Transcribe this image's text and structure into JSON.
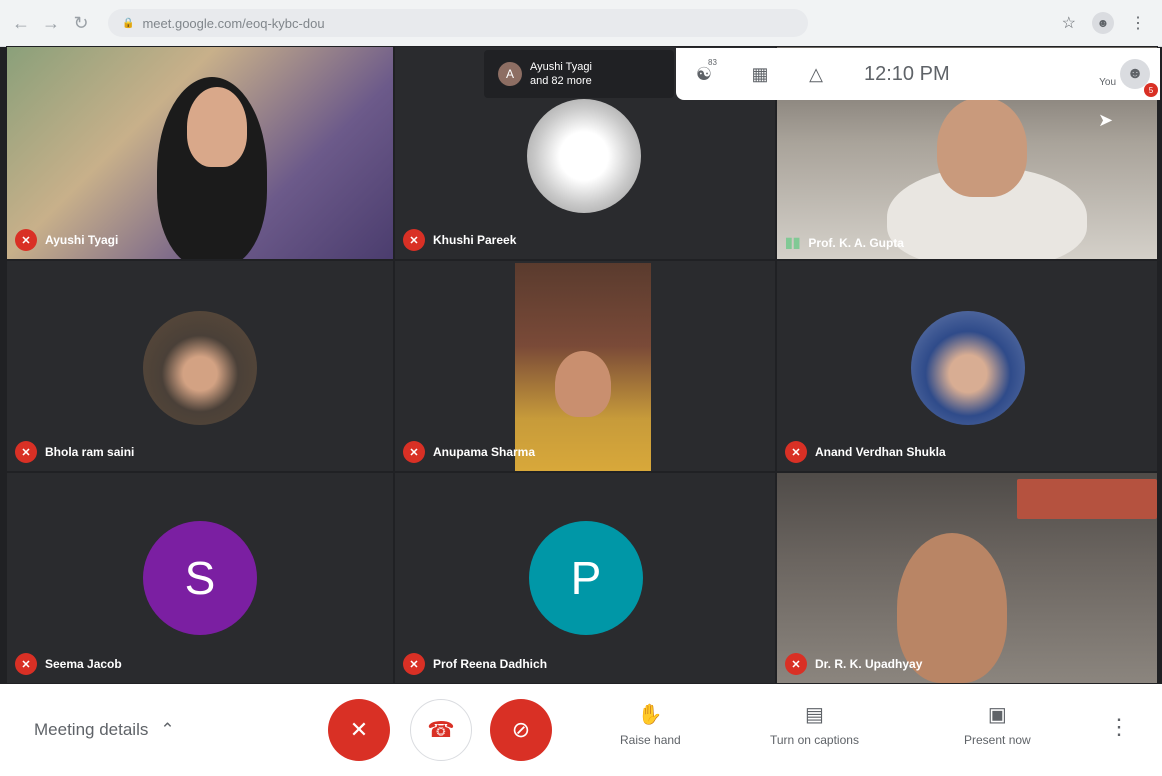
{
  "browser": {
    "url": "meet.google.com/eoq-kybc-dou"
  },
  "overlay": {
    "participant_line1": "Ayushi Tyagi",
    "participant_line2": "and 82 more",
    "participant_initial": "A",
    "people_count": "83",
    "time": "12:10 PM",
    "you_label": "You",
    "notification_count": "5"
  },
  "tiles": [
    {
      "name": "Ayushi Tyagi"
    },
    {
      "name": "Khushi Pareek"
    },
    {
      "name": "Prof. K. A. Gupta"
    },
    {
      "name": "Bhola ram saini"
    },
    {
      "name": "Anupama Sharma"
    },
    {
      "name": "Anand Verdhan Shukla"
    },
    {
      "name": "Seema Jacob",
      "initial": "S",
      "color": "#7b1fa2"
    },
    {
      "name": "Prof Reena Dadhich",
      "initial": "P",
      "color": "#0097a7"
    },
    {
      "name": "Dr. R. K. Upadhyay"
    }
  ],
  "controls": {
    "meeting_details": "Meeting details",
    "raise_hand": "Raise hand",
    "captions": "Turn on captions",
    "present": "Present now"
  },
  "colors": {
    "end_call_red": "#d93025",
    "tile_bg": "#3c4043",
    "page_bg": "#202124"
  }
}
